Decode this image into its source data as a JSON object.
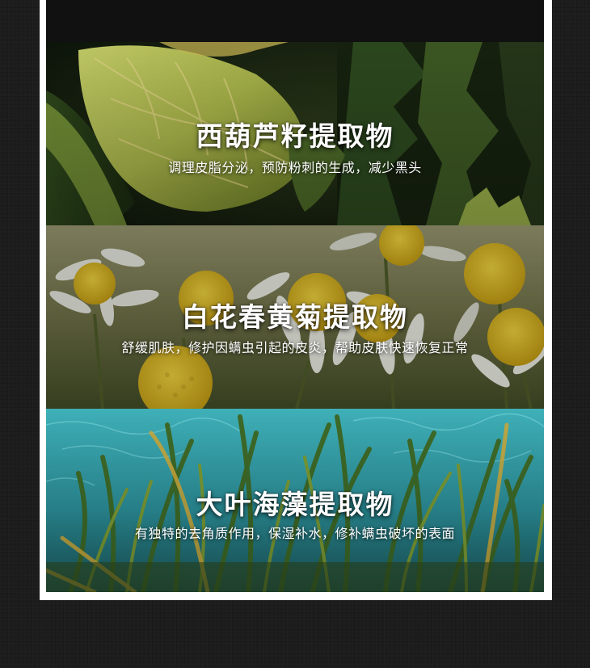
{
  "sections": [
    {
      "title": "西葫芦籽提取物",
      "description": "调理皮脂分泌，预防粉刺的生成，减少黑头",
      "image_icon": "zucchini-flower-leaves-image"
    },
    {
      "title": "白花春黄菊提取物",
      "description": "舒缓肌肤，修护因螨虫引起的皮炎，帮助皮肤快速恢复正常",
      "image_icon": "chamomile-flowers-image"
    },
    {
      "title": "大叶海藻提取物",
      "description": "有独特的去角质作用，保湿补水，修补螨虫破坏的表面",
      "image_icon": "seagrass-underwater-image"
    }
  ],
  "colors": {
    "page_background": "#1c1c1c",
    "frame": "#ffffff",
    "text": "#ffffff"
  }
}
